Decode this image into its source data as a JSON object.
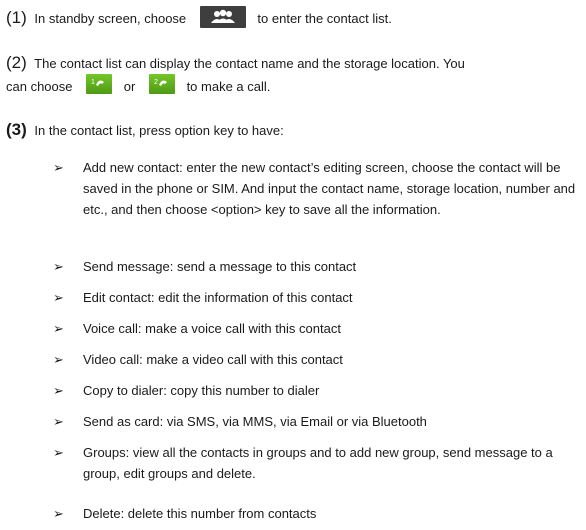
{
  "steps": [
    {
      "num": "(1)",
      "text_before": "In standby screen, choose",
      "icon": "contacts-icon",
      "text_after": "to enter the contact list."
    },
    {
      "num": "(2)",
      "text_line1": "The contact list can display the contact name and the storage location. You",
      "text_line2a": "can choose",
      "icon_a": "call-sim1-icon",
      "or": "or",
      "icon_b": "call-sim2-icon",
      "text_line2b": "to make a call."
    },
    {
      "num": "(3)",
      "text": "In the contact list, press option key to have:"
    }
  ],
  "bullets": [
    "Add new contact: enter the new contact’s editing screen, choose the contact will be saved in the phone or SIM. And input the contact name, storage location, number and etc., and then choose <option> key to save all the information.",
    "Send message: send a message to this contact",
    "Edit contact: edit the information of this contact",
    "Voice call: make a voice call with this contact",
    "Video call: make a video call with this contact",
    "Copy to dialer: copy this number to dialer",
    "Send as card: via SMS, via MMS, via Email or via Bluetooth",
    "Groups: view all the contacts in groups and to add new group, send message to a group, edit groups and delete.",
    "Delete: delete this number from contacts"
  ],
  "colors": {
    "text": "#1a1a1a",
    "contacts_icon_bg": "#3e3e3e",
    "call_icon_bg": "#5aa81c"
  }
}
